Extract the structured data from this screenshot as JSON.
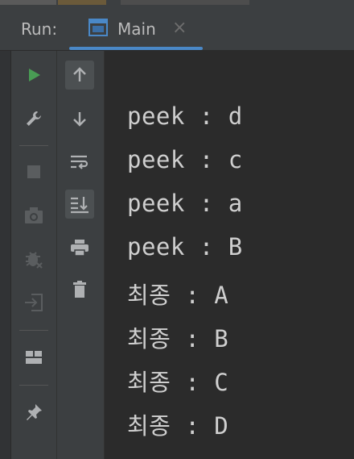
{
  "window": {
    "run_label": "Run:",
    "tab": {
      "label": "Main",
      "close_glyph": "×",
      "icon": "application-window-icon"
    }
  },
  "toolbar_left": [
    {
      "name": "rerun-icon",
      "active": false
    },
    {
      "name": "wrench-icon",
      "active": false
    },
    {
      "name": "stop-icon",
      "active": false
    },
    {
      "name": "camera-icon",
      "active": false
    },
    {
      "name": "debug-bug-icon",
      "active": false
    },
    {
      "name": "exit-icon",
      "active": false
    },
    {
      "name": "layout-icon",
      "active": false
    },
    {
      "name": "pin-icon",
      "active": false
    }
  ],
  "toolbar_right": [
    {
      "name": "up-arrow-icon",
      "active": true
    },
    {
      "name": "down-arrow-icon",
      "active": false
    },
    {
      "name": "soft-wrap-icon",
      "active": false
    },
    {
      "name": "scroll-to-end-icon",
      "active": true
    },
    {
      "name": "print-icon",
      "active": false
    },
    {
      "name": "trash-icon",
      "active": false
    }
  ],
  "console": {
    "lines": [
      "peek : d",
      "peek : c",
      "peek : a",
      "peek : B",
      "최종 : A",
      "최종 : B",
      "최종 : C",
      "최종 : D"
    ]
  },
  "colors": {
    "run_green": "#499c54",
    "accent_blue": "#4a88c7",
    "text": "#cfcfcf"
  }
}
